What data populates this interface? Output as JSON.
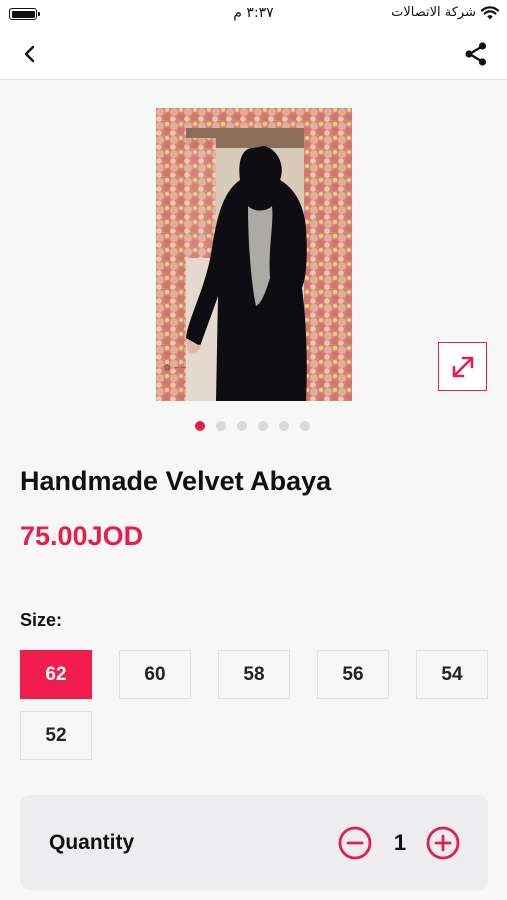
{
  "status_bar": {
    "time": "٣:٣٧ م",
    "carrier": "شركة الاتصالات"
  },
  "product": {
    "title": "Handmade Velvet Abaya",
    "price": "75.00JOD",
    "image_count": 6,
    "active_image": 1
  },
  "sizes": {
    "label": "Size:",
    "options": [
      "62",
      "60",
      "58",
      "56",
      "54",
      "52"
    ],
    "selected": "62"
  },
  "quantity": {
    "label": "Quantity",
    "value": "1"
  },
  "colors": {
    "accent": "#e41e4f"
  },
  "icons": {
    "back": "chevron-left-icon",
    "share": "share-icon",
    "expand": "expand-arrows-icon",
    "minus": "minus-circle-icon",
    "plus": "plus-circle-icon"
  }
}
